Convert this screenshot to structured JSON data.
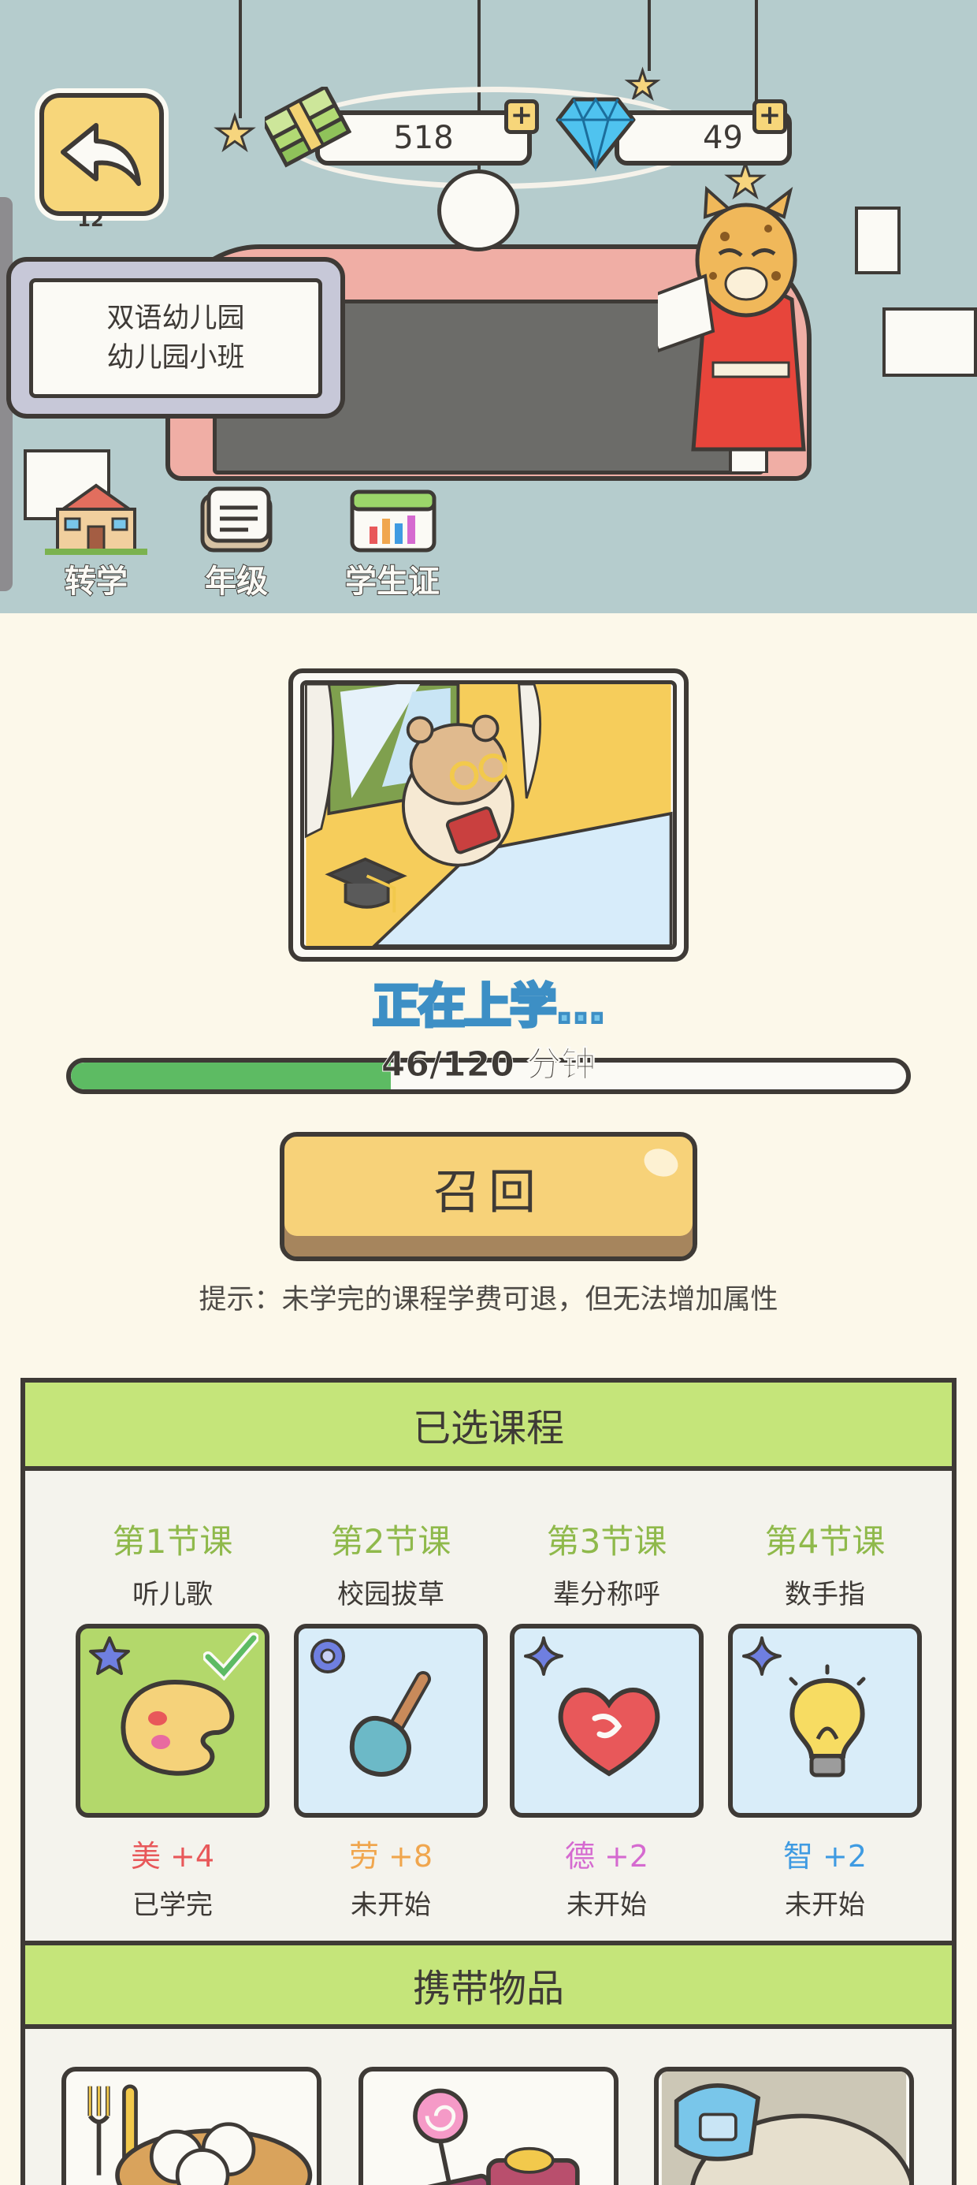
{
  "hud": {
    "clock_label": "12",
    "money": "518",
    "gems": "49",
    "plus_symbol": "+"
  },
  "school": {
    "name": "双语幼儿园",
    "class": "幼儿园小班"
  },
  "toolbar": {
    "transfer_label": "转学",
    "grade_label": "年级",
    "student_id_label": "学生证"
  },
  "studying": {
    "status_text": "正在上学...",
    "elapsed_minutes": 46,
    "total_minutes": 120,
    "progress_text": "46/120 分钟",
    "recall_label": "召回",
    "hint_text": "提示：未学完的课程学费可退，但无法增加属性"
  },
  "courses": {
    "title": "已选课程",
    "items": [
      {
        "index_label": "第1节课",
        "name": "听儿歌",
        "attr": "美 +4",
        "attr_color": "#e8585a",
        "state": "已学完",
        "icon": "palette-icon",
        "badge": "blue-star-icon",
        "completed": true
      },
      {
        "index_label": "第2节课",
        "name": "校园拔草",
        "attr": "劳 +8",
        "attr_color": "#f0a64e",
        "state": "未开始",
        "icon": "shovel-icon",
        "badge": "blue-gear-icon",
        "completed": false
      },
      {
        "index_label": "第3节课",
        "name": "辈分称呼",
        "attr": "德 +2",
        "attr_color": "#d56ad0",
        "state": "未开始",
        "icon": "handshake-heart-icon",
        "badge": "blue-sparkle-icon",
        "completed": false
      },
      {
        "index_label": "第4节课",
        "name": "数手指",
        "attr": "智 +2",
        "attr_color": "#3f9be2",
        "state": "未开始",
        "icon": "lightbulb-icon",
        "badge": "blue-sparkle-icon",
        "completed": false
      }
    ]
  },
  "carried": {
    "title": "携带物品",
    "items": [
      {
        "icon": "steamed-buns-icon"
      },
      {
        "icon": "snacks-icon"
      },
      {
        "icon": "school-bag-icon"
      }
    ]
  },
  "colors": {
    "accent_green": "#c5e57a",
    "progress_green": "#5dbb63",
    "button_yellow": "#f7d279",
    "status_blue": "#79c6ea"
  }
}
